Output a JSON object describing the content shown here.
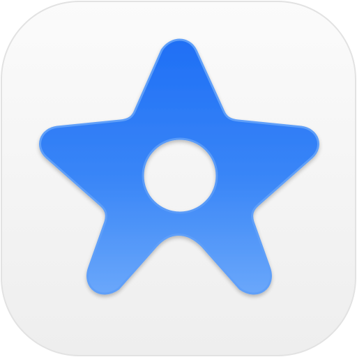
{
  "icon": {
    "name": "star-icon",
    "glyph_color": "#2f7df6",
    "tile_color": "#f6f6f6",
    "background": "#ffffff"
  }
}
